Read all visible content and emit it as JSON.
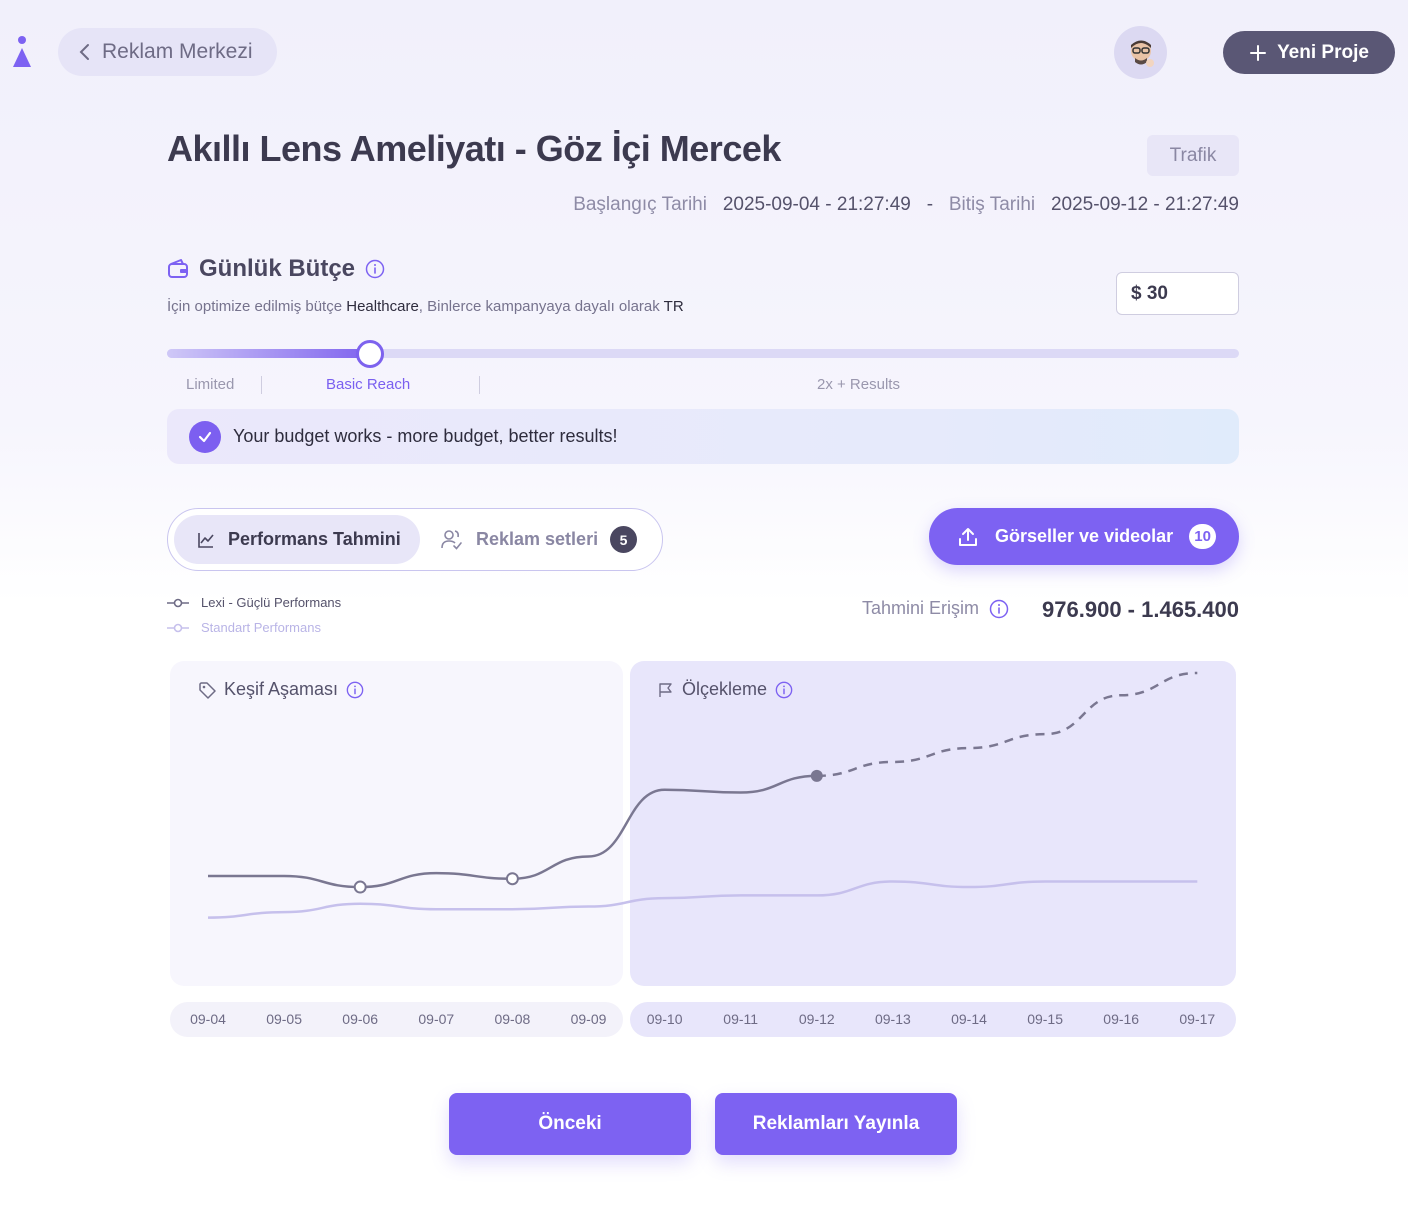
{
  "header": {
    "back_label": "Reklam Merkezi",
    "new_project_label": "Yeni Proje"
  },
  "campaign": {
    "title": "Akıllı Lens Ameliyatı - Göz İçi Mercek",
    "objective": "Trafik",
    "start_label": "Başlangıç Tarihi",
    "start_value": "2025-09-04 - 21:27:49",
    "separator": "-",
    "end_label": "Bitiş Tarihi",
    "end_value": "2025-09-12 - 21:27:49"
  },
  "budget": {
    "title": "Günlük Bütçe",
    "sub_prefix": "İçin optimize edilmiş bütçe",
    "sub_industry": "Healthcare",
    "sub_middle": ", Binlerce kampanyaya dayalı olarak",
    "sub_country": "TR",
    "value": "$ 30",
    "slider_fraction": 0.19,
    "levels": [
      "Limited",
      "Basic Reach",
      "2x + Results"
    ],
    "active_level": "Basic Reach",
    "message": "Your budget works - more budget, better results!"
  },
  "tabs": {
    "performance": "Performans Tahmini",
    "ad_sets": "Reklam setleri",
    "ad_sets_count": "5"
  },
  "media_button": {
    "label": "Görseller ve videolar",
    "count": "10"
  },
  "legend": {
    "strong": "Lexi - Güçlü Performans",
    "standard": "Standart Performans"
  },
  "reach": {
    "label": "Tahmini Erişim",
    "value": "976.900 - 1.465.400"
  },
  "phases": {
    "discovery": "Keşif Aşaması",
    "scaling": "Ölçekleme"
  },
  "chart_data": {
    "type": "line",
    "x": [
      "09-04",
      "09-05",
      "09-06",
      "09-07",
      "09-08",
      "09-09",
      "09-10",
      "09-11",
      "09-12",
      "09-13",
      "09-14",
      "09-15",
      "09-16",
      "09-17"
    ],
    "series": [
      {
        "name": "Lexi - Güçlü Performans",
        "values": [
          0.27,
          0.27,
          0.23,
          0.28,
          0.26,
          0.34,
          0.58,
          0.57,
          0.63,
          0.68,
          0.73,
          0.78,
          0.92,
          1.0
        ],
        "projected_from_index": 8,
        "color": "#7a7791"
      },
      {
        "name": "Standart Performans",
        "values": [
          0.12,
          0.14,
          0.17,
          0.15,
          0.15,
          0.16,
          0.19,
          0.2,
          0.2,
          0.25,
          0.23,
          0.25,
          0.25,
          0.25
        ],
        "color": "#c6c0ec"
      }
    ]
  },
  "actions": {
    "previous": "Önceki",
    "publish": "Reklamları Yayınla"
  },
  "colors": {
    "accent": "#7d62f2",
    "dark": "#5a5775"
  }
}
